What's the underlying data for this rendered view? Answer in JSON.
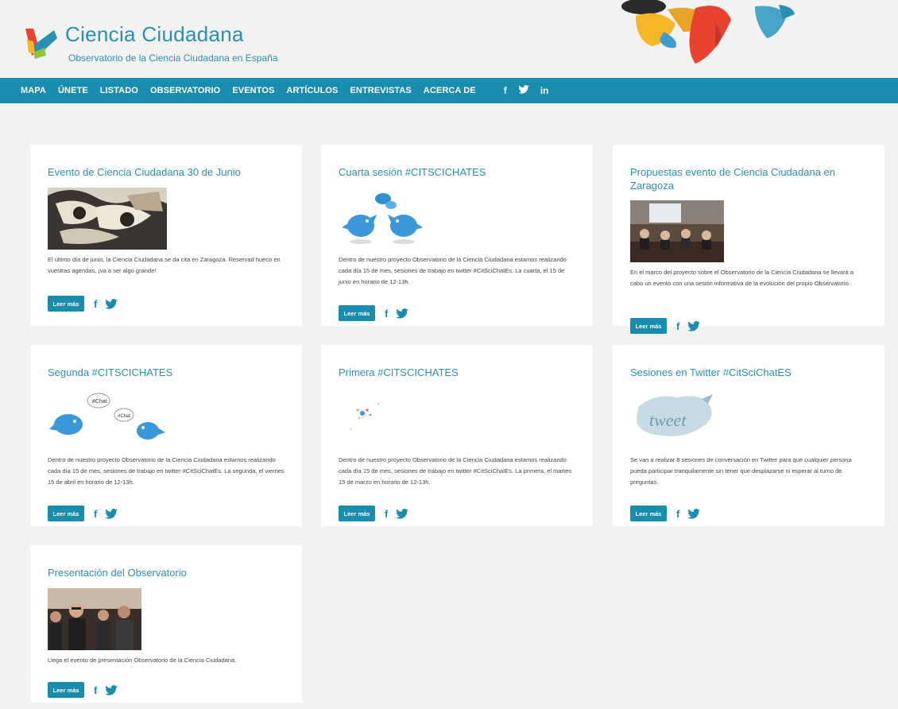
{
  "site": {
    "title": "Ciencia Ciudadana",
    "subtitle": "Observatorio de la Ciencia Ciudadana en España"
  },
  "nav": {
    "items": [
      "MAPA",
      "ÚNETE",
      "LISTADO",
      "OBSERVATORIO",
      "EVENTOS",
      "ARTÍCULOS",
      "ENTREVISTAS",
      "ACERCA DE"
    ],
    "social": [
      "f",
      "twitter",
      "in"
    ]
  },
  "colors": {
    "accent": "#1a8cae",
    "title": "#2a8fb0",
    "background": "#f2f2f2"
  },
  "read_more_label": "Leer más",
  "posts": [
    {
      "title": "Evento de Ciencia Ciudadana 30 de Junio",
      "image": "mosaic-illustration",
      "text": "El último día de junio, la Ciencia Ciudadana se da cita en Zaragoza. Reservad hueco en vuestras agendas, ¡va a ser algo grande!"
    },
    {
      "title": "Cuarta sesión #CITSCICHATES",
      "image": "twitter-birds-chat",
      "text": "Dentro de nuestro proyecto Observatorio de la Ciencia Ciudadana estamos realizando cada día 15 de mes, sesiones de trabajo en twitter #CitSciChatEs. La cuarta, el 15 de junio en horario de 12-13h."
    },
    {
      "title": "Propuestas evento de Ciencia Ciudadana en Zaragoza",
      "image": "conference-panel-photo",
      "text": "En el marco del proyecto sobre el Observatorio de la Ciencia Ciudadana se llevará a cabo un evento con una sesión informativa de la evolución del propio Observatorio."
    },
    {
      "title": "Segunda #CITSCICHATES",
      "image": "twitter-birds-chat-bubbles",
      "text": "Dentro de nuestro proyecto Observatorio de la Ciencia Ciudadana estamos realizando cada día 15 de mes, sesiones de trabajo en twitter #CitSciChatEs. La segunda, el viernes 15 de abril en horario de 12-13h."
    },
    {
      "title": "Primera #CITSCICHATES",
      "image": "network-sparkle",
      "text": "Dentro de nuestro proyecto Observatorio de la Ciencia Ciudadana estamos realizando cada día 15 de mes, sesiones de trabajo en twitter #CitSciChatEs. La primera, el martes 15 de marzo en horario de 12-13h."
    },
    {
      "title": "Sesiones en Twitter #CitSciChatES",
      "image": "tweet-word-cloud",
      "text": "Se van a realizar 8 sesiones de conversación en Twitter para que cualquier persona pueda participar tranquilamente sin tener que desplazarse ni esperar al turno de preguntas."
    },
    {
      "title": "Presentación del Observatorio",
      "image": "presentation-crowd-photo",
      "text": "Llega el evento de presentación Observatorio de la Ciencia Ciudadana."
    }
  ]
}
